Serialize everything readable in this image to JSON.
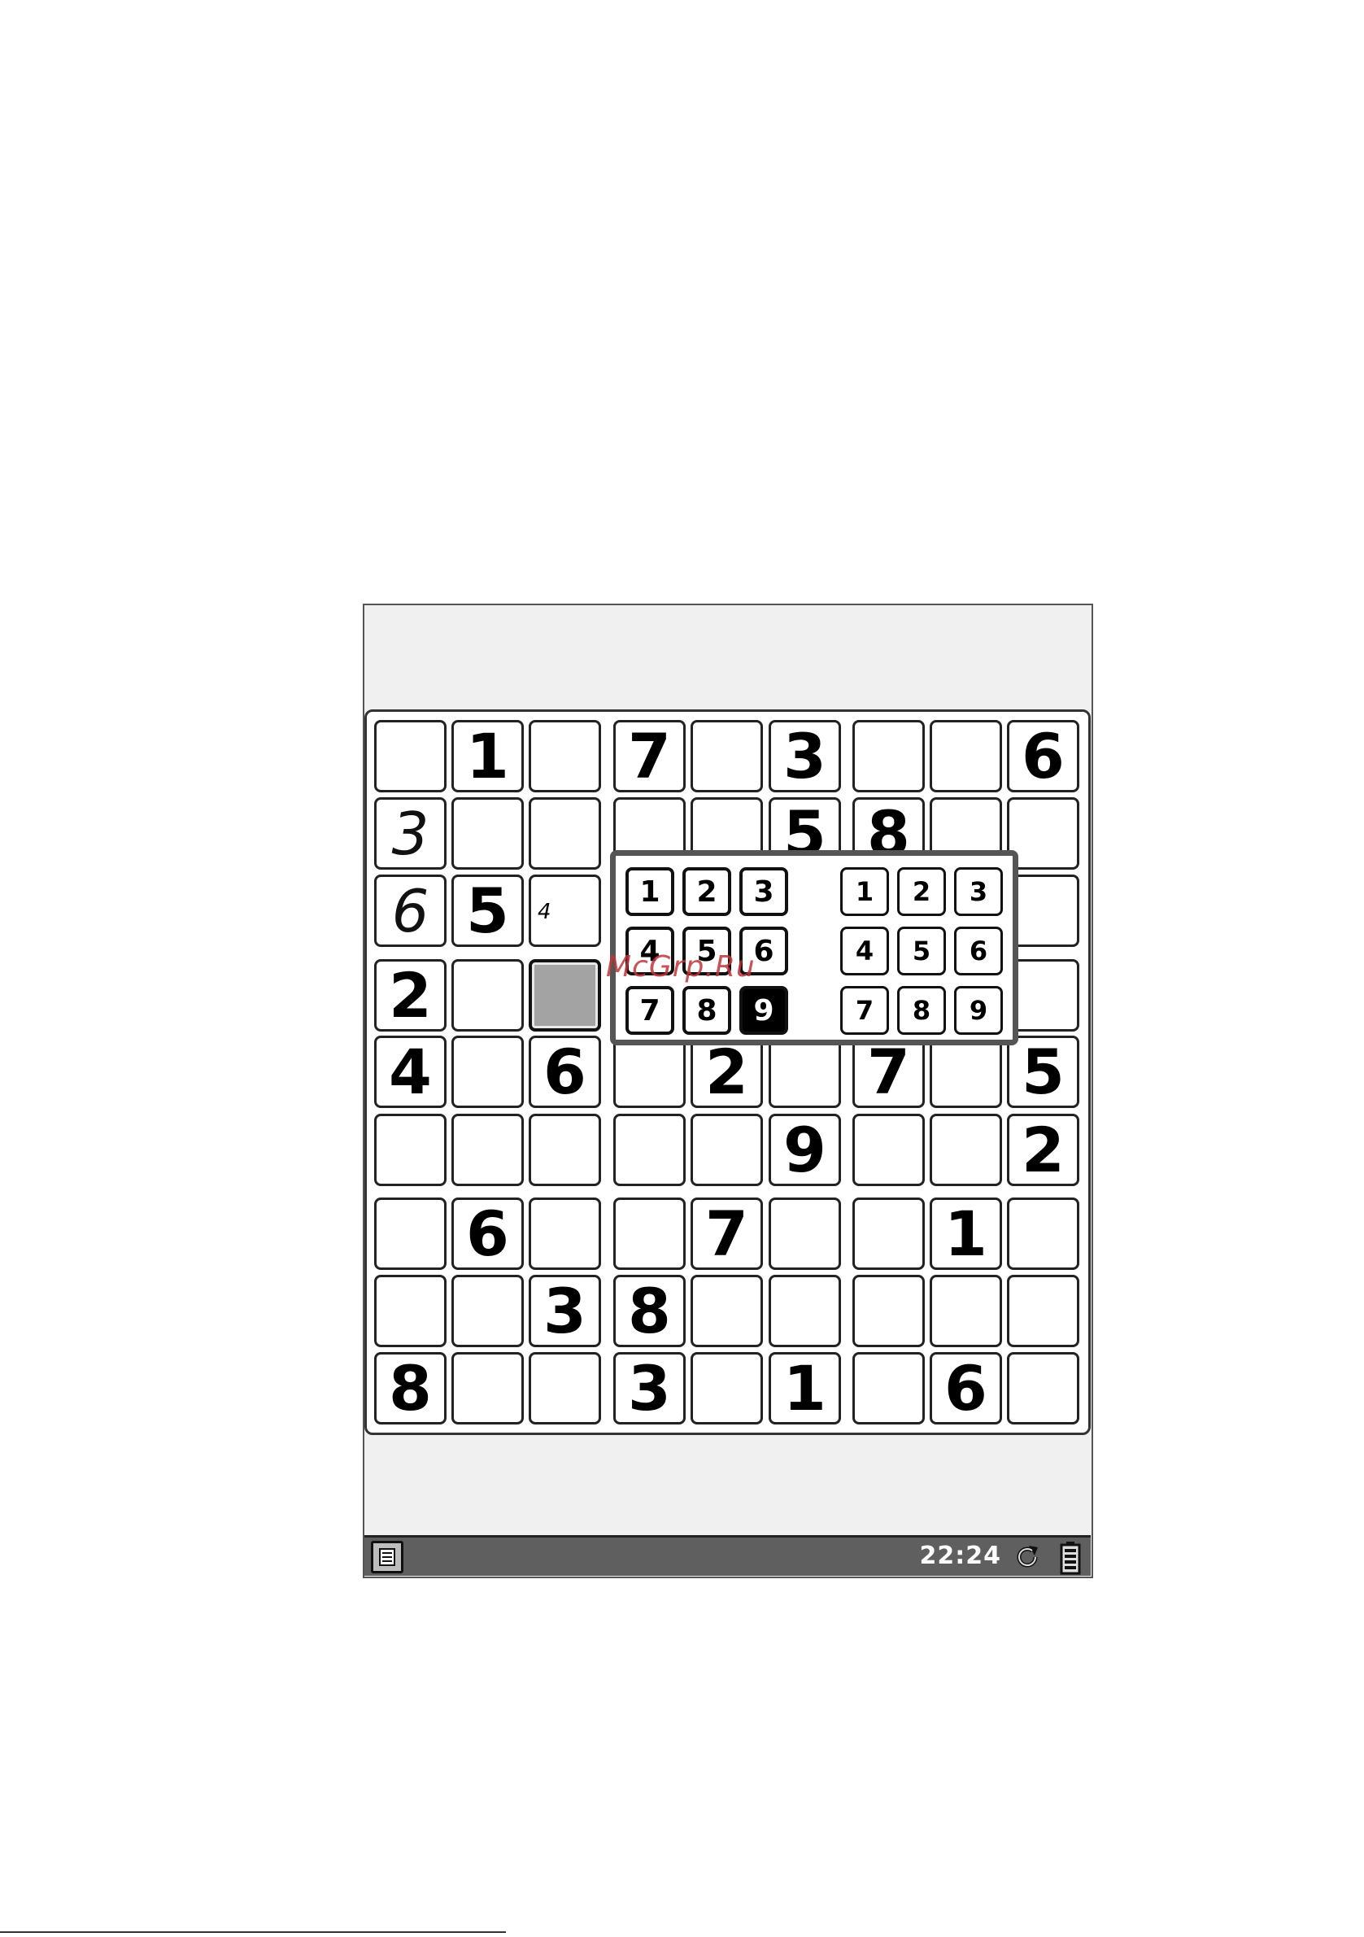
{
  "statusbar": {
    "time": "22:24"
  },
  "watermark": "McGrp.Ru",
  "footer_mark": "",
  "grid": [
    [
      {
        "v": "",
        "t": "empty"
      },
      {
        "v": "1",
        "t": "given"
      },
      {
        "v": "",
        "t": "empty"
      },
      {
        "v": "7",
        "t": "given"
      },
      {
        "v": "",
        "t": "empty"
      },
      {
        "v": "3",
        "t": "given"
      },
      {
        "v": "",
        "t": "empty"
      },
      {
        "v": "",
        "t": "empty"
      },
      {
        "v": "6",
        "t": "given"
      }
    ],
    [
      {
        "v": "3",
        "t": "user"
      },
      {
        "v": "",
        "t": "empty"
      },
      {
        "v": "",
        "t": "empty"
      },
      {
        "v": "",
        "t": "empty"
      },
      {
        "v": "",
        "t": "empty"
      },
      {
        "v": "5",
        "t": "given"
      },
      {
        "v": "8",
        "t": "given"
      },
      {
        "v": "",
        "t": "empty"
      },
      {
        "v": "",
        "t": "empty"
      }
    ],
    [
      {
        "v": "6",
        "t": "user"
      },
      {
        "v": "5",
        "t": "given"
      },
      {
        "v": "4",
        "t": "pencil"
      },
      {
        "v": "",
        "t": "empty"
      },
      {
        "v": "",
        "t": "empty"
      },
      {
        "v": "",
        "t": "empty"
      },
      {
        "v": "",
        "t": "empty"
      },
      {
        "v": "",
        "t": "empty"
      },
      {
        "v": "",
        "t": "empty"
      }
    ],
    [
      {
        "v": "2",
        "t": "given"
      },
      {
        "v": "",
        "t": "empty"
      },
      {
        "v": "",
        "t": "selected"
      },
      {
        "v": "",
        "t": "empty"
      },
      {
        "v": "",
        "t": "empty"
      },
      {
        "v": "",
        "t": "empty"
      },
      {
        "v": "",
        "t": "empty"
      },
      {
        "v": "",
        "t": "empty"
      },
      {
        "v": "",
        "t": "empty"
      }
    ],
    [
      {
        "v": "4",
        "t": "given"
      },
      {
        "v": "",
        "t": "empty"
      },
      {
        "v": "6",
        "t": "given"
      },
      {
        "v": "",
        "t": "empty"
      },
      {
        "v": "2",
        "t": "given"
      },
      {
        "v": "",
        "t": "empty"
      },
      {
        "v": "7",
        "t": "given"
      },
      {
        "v": "",
        "t": "empty"
      },
      {
        "v": "5",
        "t": "given"
      }
    ],
    [
      {
        "v": "",
        "t": "empty"
      },
      {
        "v": "",
        "t": "empty"
      },
      {
        "v": "",
        "t": "empty"
      },
      {
        "v": "",
        "t": "empty"
      },
      {
        "v": "",
        "t": "empty"
      },
      {
        "v": "9",
        "t": "given"
      },
      {
        "v": "",
        "t": "empty"
      },
      {
        "v": "",
        "t": "empty"
      },
      {
        "v": "2",
        "t": "given"
      }
    ],
    [
      {
        "v": "",
        "t": "empty"
      },
      {
        "v": "6",
        "t": "given"
      },
      {
        "v": "",
        "t": "empty"
      },
      {
        "v": "",
        "t": "empty"
      },
      {
        "v": "7",
        "t": "given"
      },
      {
        "v": "",
        "t": "empty"
      },
      {
        "v": "",
        "t": "empty"
      },
      {
        "v": "1",
        "t": "given"
      },
      {
        "v": "",
        "t": "empty"
      }
    ],
    [
      {
        "v": "",
        "t": "empty"
      },
      {
        "v": "",
        "t": "empty"
      },
      {
        "v": "3",
        "t": "given"
      },
      {
        "v": "8",
        "t": "given"
      },
      {
        "v": "",
        "t": "empty"
      },
      {
        "v": "",
        "t": "empty"
      },
      {
        "v": "",
        "t": "empty"
      },
      {
        "v": "",
        "t": "empty"
      },
      {
        "v": "",
        "t": "empty"
      }
    ],
    [
      {
        "v": "8",
        "t": "given"
      },
      {
        "v": "",
        "t": "empty"
      },
      {
        "v": "",
        "t": "empty"
      },
      {
        "v": "3",
        "t": "given"
      },
      {
        "v": "",
        "t": "empty"
      },
      {
        "v": "1",
        "t": "given"
      },
      {
        "v": "",
        "t": "empty"
      },
      {
        "v": "6",
        "t": "given"
      },
      {
        "v": "",
        "t": "empty"
      }
    ]
  ],
  "picker": {
    "digits": [
      "1",
      "2",
      "3",
      "4",
      "5",
      "6",
      "7",
      "8",
      "9"
    ],
    "notes": [
      "1",
      "2",
      "3",
      "4",
      "5",
      "6",
      "7",
      "8",
      "9"
    ],
    "active_digit": "9"
  }
}
